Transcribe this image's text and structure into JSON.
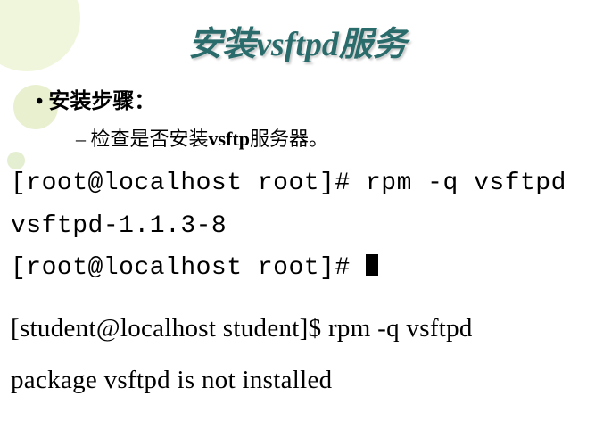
{
  "title": "安装vsftpd服务",
  "bullets": {
    "level1": "安装步骤：",
    "level2_prefix": "检查是否安装",
    "level2_bold": "vsftp",
    "level2_suffix": "服务器。"
  },
  "terminal_root": {
    "line1": "[root@localhost root]# rpm -q vsftpd",
    "line2": "vsftpd-1.1.3-8",
    "line3": "[root@localhost root]# "
  },
  "terminal_student": {
    "line1": "[student@localhost student]$ rpm -q vsftpd",
    "line2": "package vsftpd is not installed"
  }
}
